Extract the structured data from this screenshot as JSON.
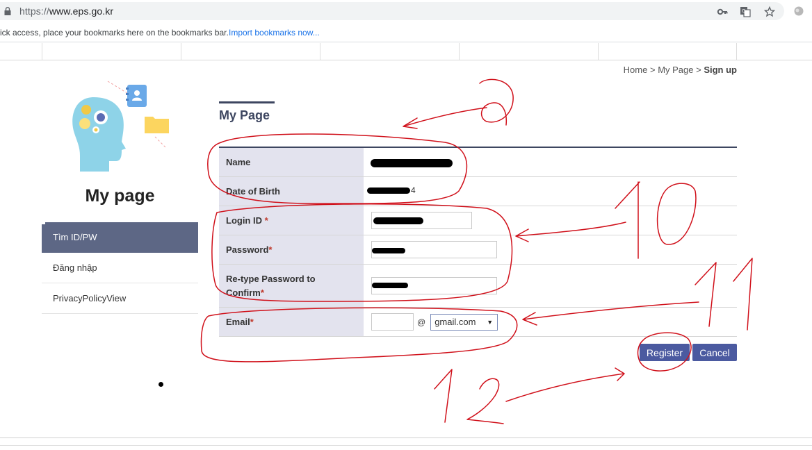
{
  "browser": {
    "url_protocol": "https://",
    "url_host": "www.eps.go.kr",
    "bookmarks_text": "ick access, place your bookmarks here on the bookmarks bar.",
    "import_link": "Import bookmarks now..."
  },
  "breadcrumb": {
    "home": "Home",
    "sep1": " > ",
    "mypage": "My Page",
    "sep2": " > ",
    "current": "Sign up"
  },
  "sidebar": {
    "title": "My page",
    "items": [
      {
        "label": "Tìm ID/PW",
        "active": true
      },
      {
        "label": "Đăng nhập",
        "active": false
      },
      {
        "label": "PrivacyPolicyView",
        "active": false
      }
    ]
  },
  "main": {
    "title": "My Page",
    "form": {
      "name_label": "Name",
      "dob_label": "Date of Birth",
      "dob_suffix": "4",
      "login_label": "Login ID",
      "password_label": "Password",
      "retype_label_1": "Re-type Password to",
      "retype_label_2": "Confirm",
      "email_label": "Email",
      "required_mark": "*",
      "email_at": "@",
      "email_domain": "gmail.com"
    },
    "buttons": {
      "register": "Register",
      "cancel": "Cancel"
    }
  },
  "annotations": {
    "numbers": [
      "9",
      "10",
      "11",
      "12"
    ],
    "color": "#d0101a"
  }
}
